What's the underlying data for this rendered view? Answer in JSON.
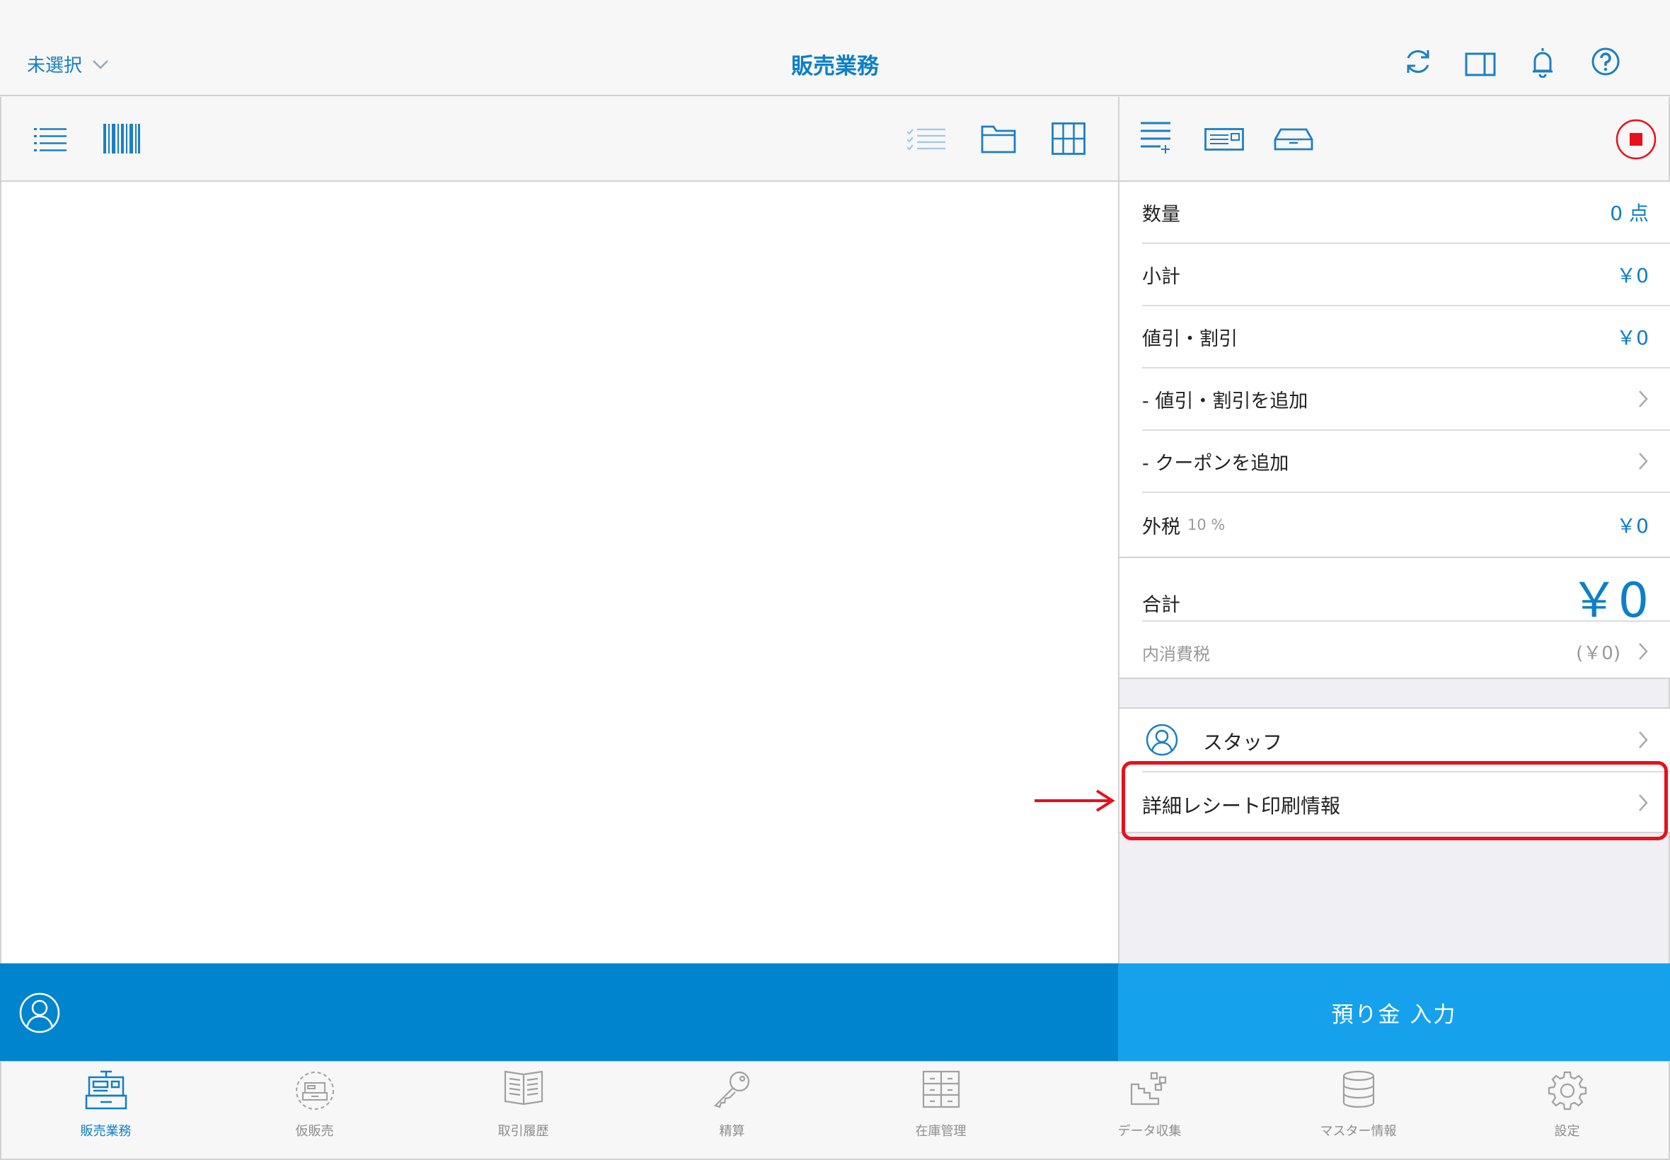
{
  "header": {
    "store_selector": "未選択",
    "title": "販売業務"
  },
  "summary": {
    "quantity_label": "数量",
    "quantity_value": "0 点",
    "subtotal_label": "小計",
    "subtotal_value": "￥0",
    "discount_label": "値引・割引",
    "discount_value": "￥0",
    "add_discount_label": "- 値引・割引を追加",
    "add_coupon_label": "- クーポンを追加",
    "external_tax_label": "外税",
    "external_tax_rate": "10 %",
    "external_tax_value": "￥0",
    "total_label": "合計",
    "total_value": "￥0",
    "internal_tax_label": "内消費税",
    "internal_tax_value": "(￥0)"
  },
  "options": {
    "staff_label": "スタッフ",
    "receipt_info_label": "詳細レシート印刷情報"
  },
  "actions": {
    "deposit_label": "預り金 入力"
  },
  "tabs": [
    {
      "label": "販売業務",
      "icon": "register-icon",
      "active": true
    },
    {
      "label": "仮販売",
      "icon": "provisional-register-icon",
      "active": false
    },
    {
      "label": "取引履歴",
      "icon": "book-icon",
      "active": false
    },
    {
      "label": "精算",
      "icon": "key-icon",
      "active": false
    },
    {
      "label": "在庫管理",
      "icon": "drawers-icon",
      "active": false
    },
    {
      "label": "データ収集",
      "icon": "data-collection-icon",
      "active": false
    },
    {
      "label": "マスター情報",
      "icon": "database-icon",
      "active": false
    },
    {
      "label": "設定",
      "icon": "gear-icon",
      "active": false
    }
  ],
  "colors": {
    "accent": "#0d7fc8",
    "customer_bar": "#0184ce",
    "deposit_button": "#16a1ec",
    "highlight": "#e8101a"
  }
}
